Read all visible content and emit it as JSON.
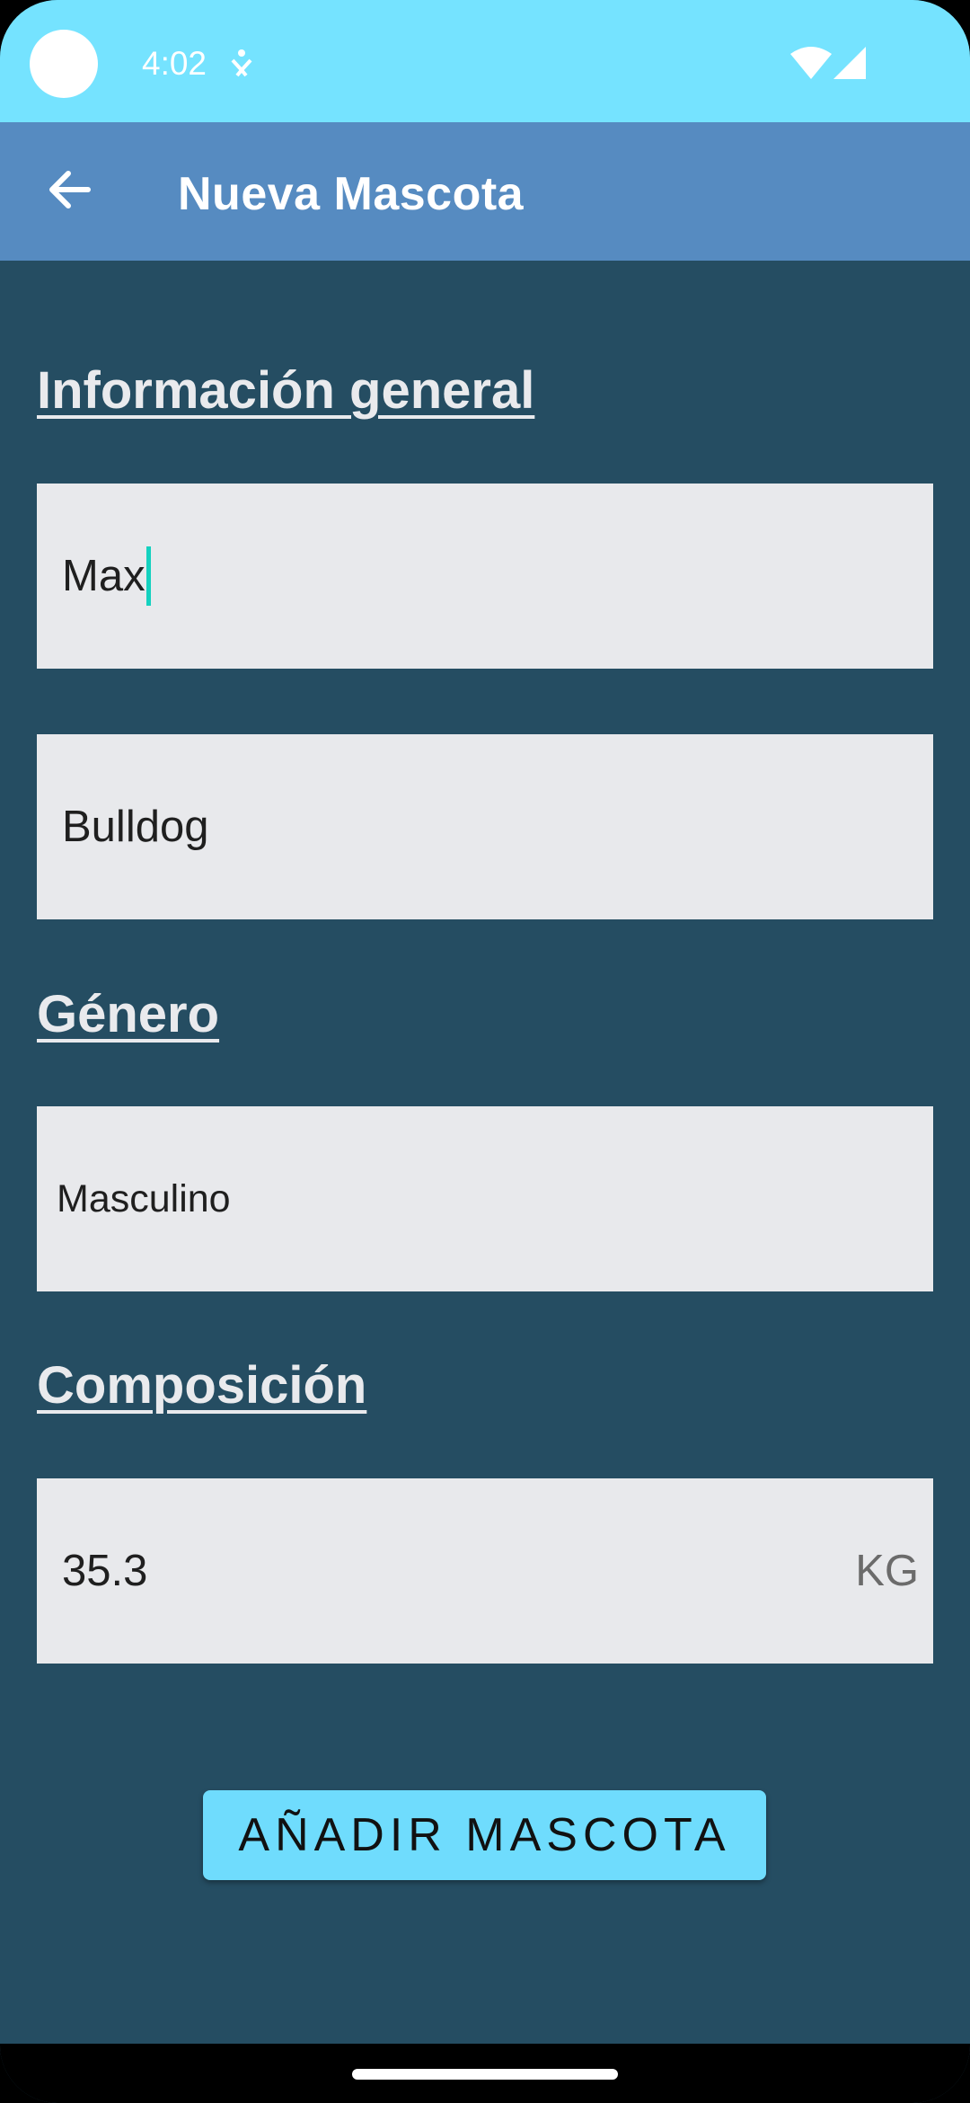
{
  "status_bar": {
    "time": "4:02",
    "icons": [
      "camera-dot-icon",
      "accessibility-icon",
      "wifi-icon",
      "signal-icon"
    ]
  },
  "app_bar": {
    "back_icon": "arrow-back-icon",
    "title": "Nueva Mascota"
  },
  "form": {
    "general_heading": "Información general",
    "name_value": "Max",
    "breed_value": "Bulldog",
    "gender_heading": "Género",
    "gender_value": "Masculino",
    "composition_heading": "Composición",
    "weight_value": "35.3",
    "weight_unit": "KG"
  },
  "actions": {
    "add_label": "AÑADIR MASCOTA"
  },
  "colors": {
    "status_bar": "#75e3ff",
    "app_bar": "#568bc1",
    "background": "#254d62",
    "field": "#e8e9ec",
    "button": "#6fdcfd",
    "cursor": "#14d1bf"
  }
}
